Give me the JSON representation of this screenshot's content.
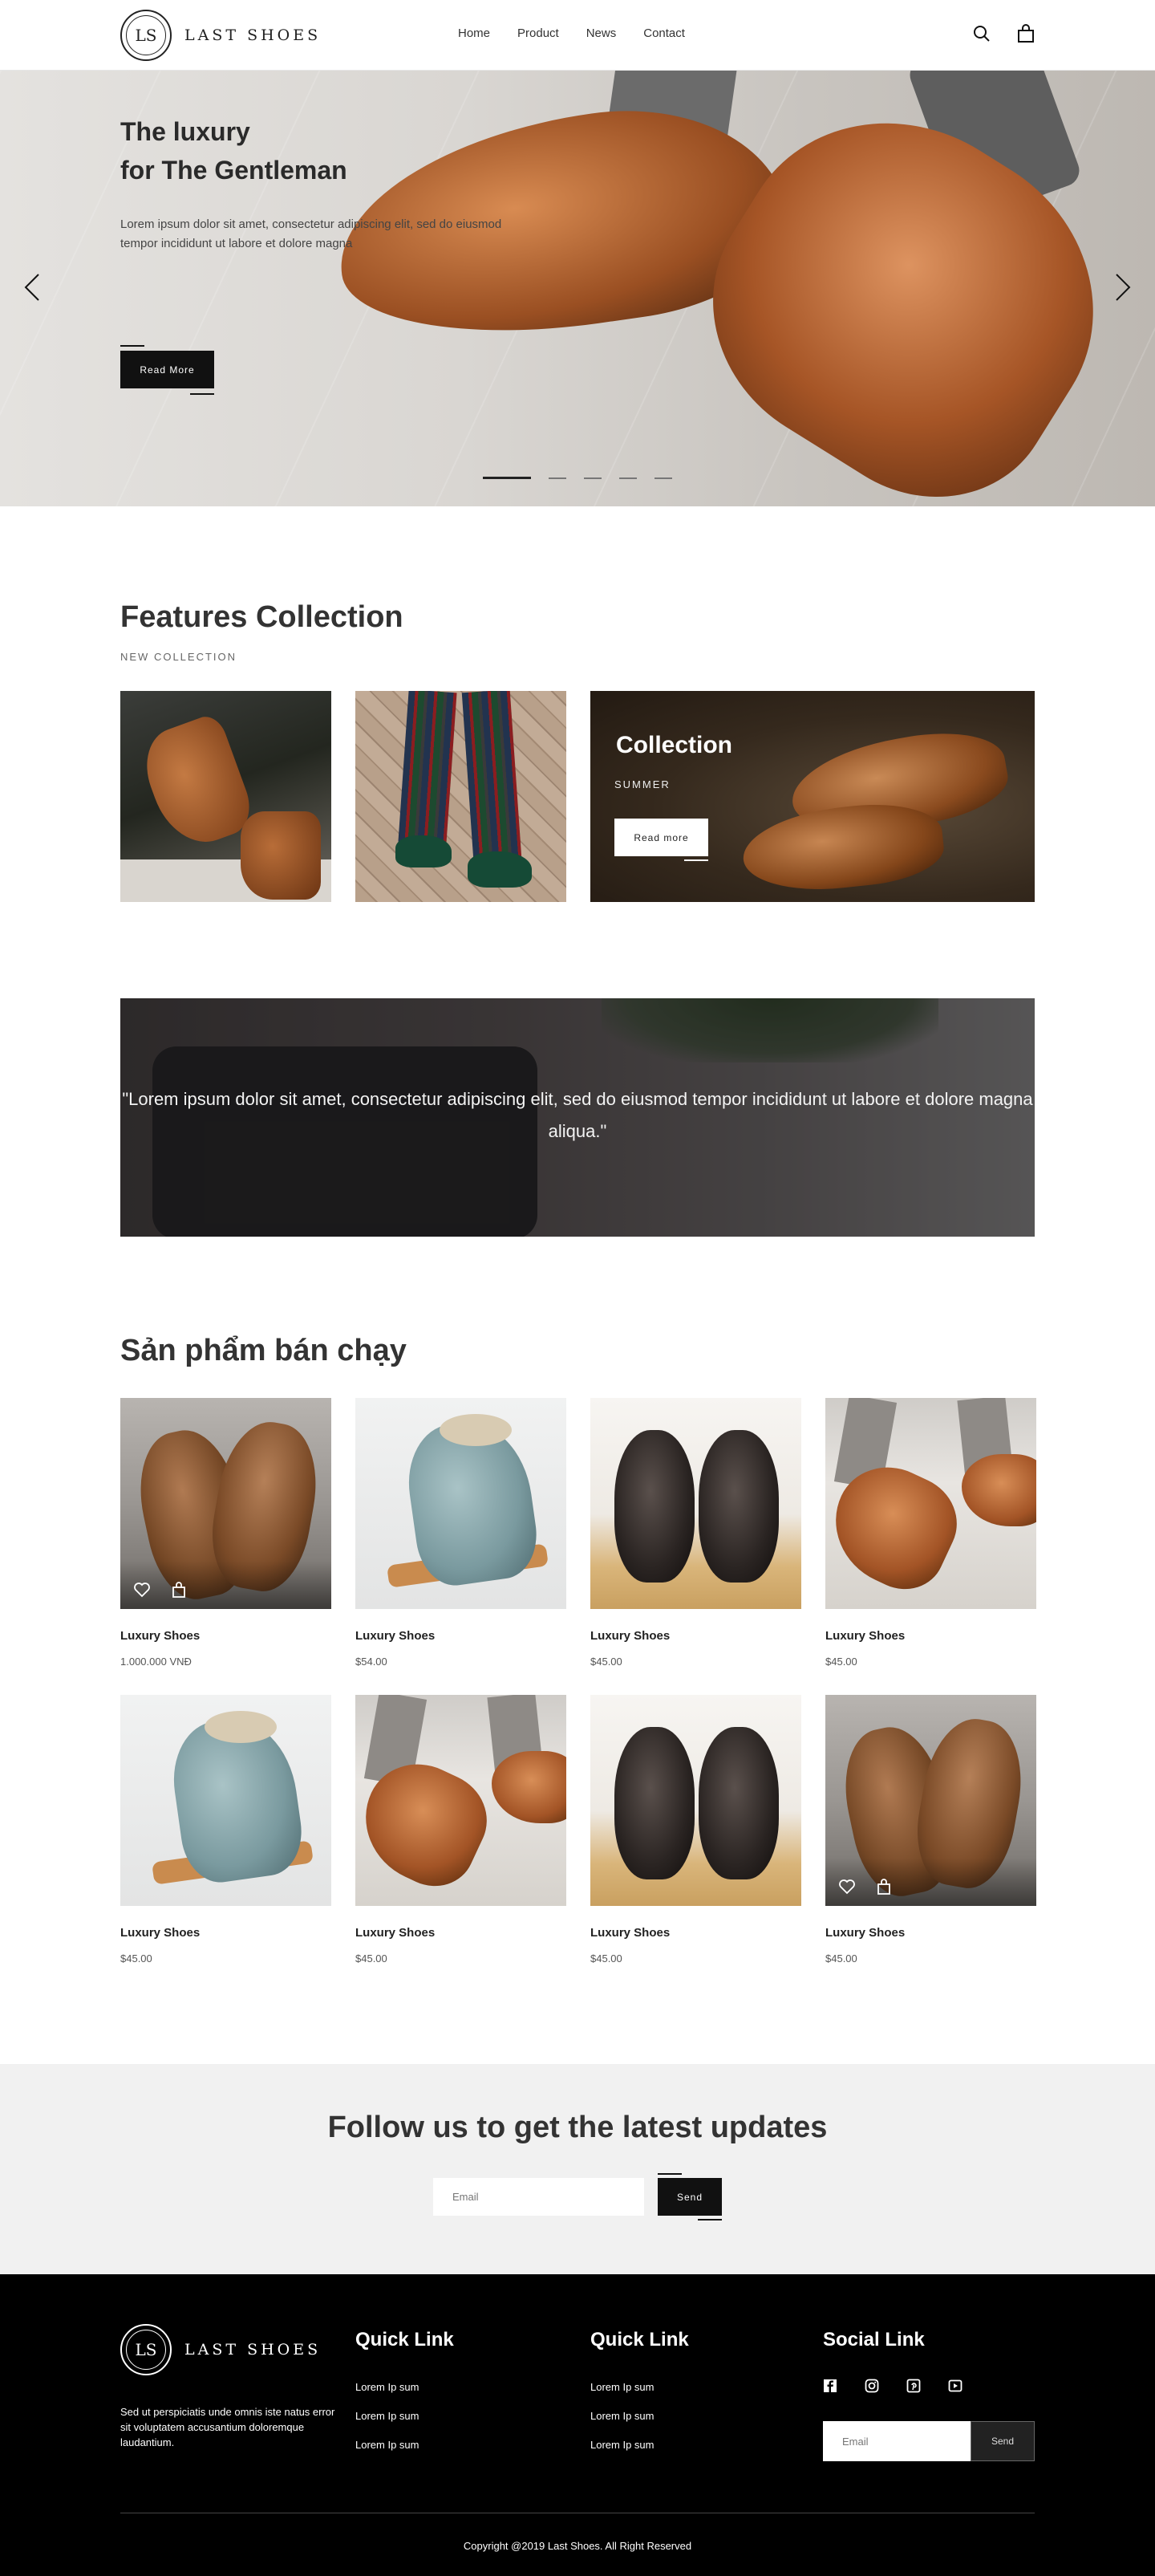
{
  "brand": {
    "logo_initials": "LS",
    "name": "LAST SHOES"
  },
  "nav": {
    "items": [
      "Home",
      "Product",
      "News",
      "Contact"
    ]
  },
  "header_icons": [
    "search-icon",
    "bag-icon"
  ],
  "hero": {
    "title_line1": "The luxury",
    "title_line2": "for The Gentleman",
    "text": "Lorem ipsum dolor sit amet, consectetur adipiscing elit, sed do eiusmod tempor incididunt ut labore et dolore magna",
    "button": "Read More",
    "slides": 5,
    "active_slide": 1
  },
  "features": {
    "title": "Features Collection",
    "subtitle": "NEW COLLECTION",
    "promo": {
      "title": "Collection",
      "subtitle": "SUMMER",
      "button": "Read more"
    }
  },
  "quote": {
    "text": "\"Lorem ipsum dolor sit amet, consectetur adipiscing elit, sed do eiusmod tempor incididunt ut labore et dolore magna aliqua.\""
  },
  "bestsellers": {
    "title": "Sản phẩm bán chạy",
    "products": [
      {
        "name": "Luxury Shoes",
        "price": "1.000.000 VNĐ"
      },
      {
        "name": "Luxury Shoes",
        "price": "$54.00"
      },
      {
        "name": "Luxury Shoes",
        "price": "$45.00"
      },
      {
        "name": "Luxury Shoes",
        "price": "$45.00"
      },
      {
        "name": "Luxury Shoes",
        "price": "$45.00"
      },
      {
        "name": "Luxury Shoes",
        "price": "$45.00"
      },
      {
        "name": "Luxury Shoes",
        "price": "$45.00"
      },
      {
        "name": "Luxury Shoes",
        "price": "$45.00"
      }
    ]
  },
  "newsletter": {
    "title": "Follow us to get the latest updates",
    "placeholder": "Email",
    "button": "Send"
  },
  "footer": {
    "description": "Sed ut perspiciatis unde omnis iste natus error sit voluptatem accusantium doloremque laudantium.",
    "col1": {
      "title": "Quick Link",
      "links": [
        "Lorem Ip sum",
        "Lorem Ip sum",
        "Lorem Ip sum"
      ]
    },
    "col2": {
      "title": "Quick Link",
      "links": [
        "Lorem Ip sum",
        "Lorem Ip sum",
        "Lorem Ip sum"
      ]
    },
    "social": {
      "title": "Social Link",
      "icons": [
        "facebook-icon",
        "instagram-icon",
        "pinterest-icon",
        "youtube-icon"
      ],
      "placeholder": "Email",
      "button": "Send"
    },
    "copyright": "Copyright @2019 Last Shoes. All Right Reserved"
  }
}
